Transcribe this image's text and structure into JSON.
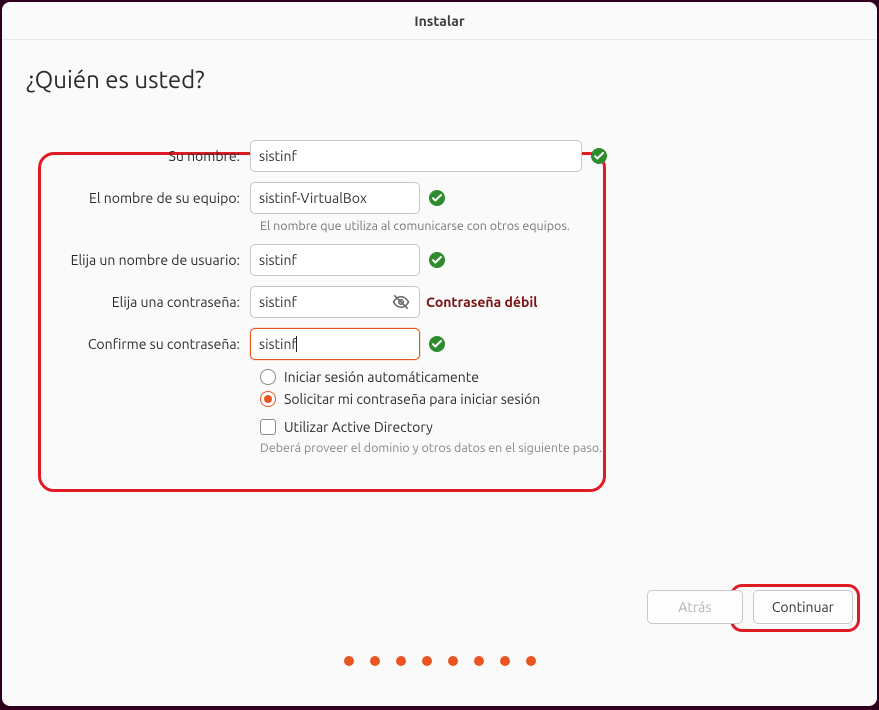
{
  "window": {
    "title": "Instalar"
  },
  "page": {
    "heading": "¿Quién es usted?"
  },
  "form": {
    "name": {
      "label": "Su nombre:",
      "value": "sistinf"
    },
    "hostname": {
      "label": "El nombre de su equipo:",
      "value": "sistinf-VirtualBox",
      "hint": "El nombre que utiliza al comunicarse con otros equipos."
    },
    "username": {
      "label": "Elija un nombre de usuario:",
      "value": "sistinf"
    },
    "password": {
      "label": "Elija una contraseña:",
      "value": "sistinf",
      "strength": "Contraseña débil"
    },
    "confirm": {
      "label": "Confirme su contraseña:",
      "value": "sistinf"
    },
    "login": {
      "auto": "Iniciar sesión automáticamente",
      "require": "Solicitar mi contraseña para iniciar sesión",
      "selected": "require"
    },
    "ad": {
      "label": "Utilizar Active Directory",
      "hint": "Deberá proveer el dominio y otros datos en el siguiente paso."
    }
  },
  "buttons": {
    "back": "Atrás",
    "continue": "Continuar"
  }
}
